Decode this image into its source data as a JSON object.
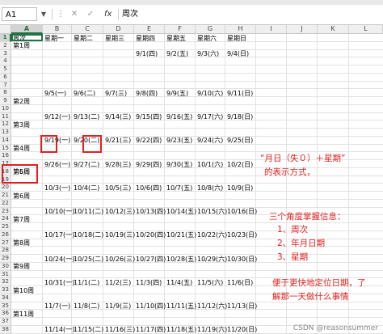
{
  "formula_bar": {
    "name_box": "A1",
    "function_label": "fx",
    "cancel_symbol": "✕",
    "confirm_symbol": "✓",
    "content": "周次"
  },
  "columns": [
    "A",
    "B",
    "C",
    "D",
    "E",
    "F",
    "G",
    "H",
    "I",
    "J",
    "K",
    "L"
  ],
  "rows": [
    "1",
    "2",
    "3",
    "4",
    "5",
    "6",
    "7",
    "8",
    "9",
    "10",
    "11",
    "12",
    "13",
    "14",
    "15",
    "16",
    "17",
    "18",
    "19",
    "20",
    "21",
    "22",
    "23",
    "24",
    "25",
    "26",
    "27",
    "28",
    "29",
    "30",
    "31",
    "32",
    "33",
    "34",
    "35",
    "36",
    "37",
    "38"
  ],
  "headers": [
    "周次",
    "星期一",
    "星期二",
    "星期三",
    "星期四",
    "星期五",
    "星期六",
    "星期日"
  ],
  "weeks": [
    {
      "label": "第1周",
      "dates": [
        "",
        "",
        "",
        "9/1(四)",
        "9/2(五)",
        "9/3(六)",
        "9/4(日)"
      ]
    },
    {
      "label": "第2周",
      "dates": [
        "9/5(一)",
        "9/6(二)",
        "9/7(三)",
        "9/8(四)",
        "9/9(五)",
        "9/10(六)",
        "9/11(日)"
      ]
    },
    {
      "label": "第3周",
      "dates": [
        "9/12(一)",
        "9/13(二)",
        "9/14(三)",
        "9/15(四)",
        "9/16(五)",
        "9/17(六)",
        "9/18(日)"
      ]
    },
    {
      "label": "第4周",
      "dates": [
        "9/19(一)",
        "9/20(二)",
        "9/21(三)",
        "9/22(四)",
        "9/23(五)",
        "9/24(六)",
        "9/25(日)"
      ]
    },
    {
      "label": "第5周",
      "dates": [
        "9/26(一)",
        "9/27(二)",
        "9/28(三)",
        "9/29(四)",
        "9/30(五)",
        "10/1(六)",
        "10/2(日)"
      ]
    },
    {
      "label": "第6周",
      "dates": [
        "10/3(一)",
        "10/4(二)",
        "10/5(三)",
        "10/6(四)",
        "10/7(五)",
        "10/8(六)",
        "10/9(日)"
      ]
    },
    {
      "label": "第7周",
      "dates": [
        "10/10(一)",
        "10/11(二)",
        "10/12(三)",
        "10/13(四)",
        "10/14(五)",
        "10/15(六)",
        "10/16(日)"
      ]
    },
    {
      "label": "第8周",
      "dates": [
        "10/17(一)",
        "10/18(二)",
        "10/19(三)",
        "10/20(四)",
        "10/21(五)",
        "10/22(六)",
        "10/23(日)"
      ]
    },
    {
      "label": "第9周",
      "dates": [
        "10/24(一)",
        "10/25(二)",
        "10/26(三)",
        "10/27(四)",
        "10/28(五)",
        "10/29(六)",
        "10/30(日)"
      ]
    },
    {
      "label": "第10周",
      "dates": [
        "10/31(一)",
        "11/1(二)",
        "11/2(三)",
        "11/3(四)",
        "11/4(五)",
        "11/5(六)",
        "11/6(日)"
      ]
    },
    {
      "label": "第11周",
      "dates": [
        "11/7(一)",
        "11/8(二)",
        "11/9(三)",
        "11/10(四)",
        "11/11(五)",
        "11/12(六)",
        "11/13(日)"
      ]
    },
    {
      "label": "第12周",
      "dates": [
        "11/14(一)",
        "11/15(二)",
        "11/16(三)",
        "11/17(四)",
        "11/18(五)",
        "11/19(六)",
        "11/20(日)"
      ]
    }
  ],
  "extra_label": "第6周",
  "annotations": {
    "format_line1": "“月日（失０）＋星期”",
    "format_line2": "的表示方式，",
    "grasp_title": "三个角度掌握信息：",
    "grasp_1": "1、周次",
    "grasp_2": "2、年月日期",
    "grasp_3": "3、星期",
    "purpose_line1": "便于更快地定位日期，了",
    "purpose_line2": "解那一天做什么事情"
  },
  "watermark": "CSDN @reasonsummer",
  "colors": {
    "selection": "#217346",
    "annotation_red": "#e0201f",
    "header_bg": "#efefef",
    "grid": "#e2e2e2"
  }
}
